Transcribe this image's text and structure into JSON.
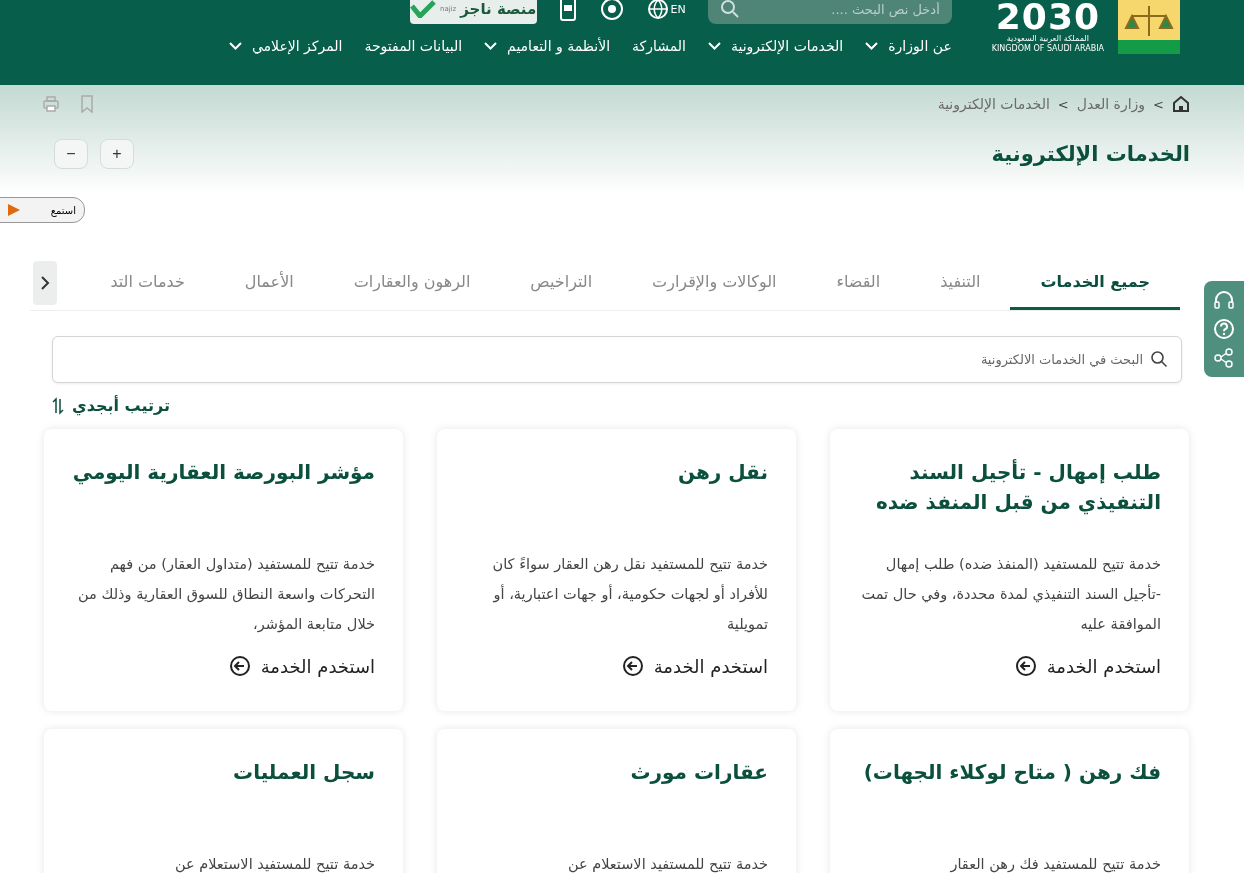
{
  "header": {
    "search": {
      "placeholder": "أدخل نص البحث ...."
    },
    "language": "EN",
    "najiz": {
      "label": "منصة ناجز",
      "sub": "najiz"
    },
    "vision": {
      "number": "2030",
      "arabic": "المملكة العربية السعودية",
      "english": "KINGDOM OF SAUDI ARABIA"
    },
    "nav": [
      {
        "label": "عن الوزارة",
        "dropdown": true
      },
      {
        "label": "الخدمات الإلكترونية",
        "dropdown": true
      },
      {
        "label": "المشاركة",
        "dropdown": false
      },
      {
        "label": "الأنظمة و التعاميم",
        "dropdown": true
      },
      {
        "label": "البيانات المفتوحة",
        "dropdown": false
      },
      {
        "label": "المركز الإعلامي",
        "dropdown": true
      }
    ]
  },
  "breadcrumb": [
    {
      "separator": ">",
      "label": "وزارة العدل"
    },
    {
      "separator": ">",
      "label": "الخدمات الإلكترونية"
    }
  ],
  "page_title": "الخدمات الإلكترونية",
  "zoom_buttons": [
    "+",
    "−"
  ],
  "listen": "استمع",
  "tabs": [
    {
      "label": "جميع الخدمات",
      "selected": true
    },
    {
      "label": "التنفيذ",
      "selected": false
    },
    {
      "label": "القضاء",
      "selected": false
    },
    {
      "label": "الوكالات والإقرارت",
      "selected": false
    },
    {
      "label": "التراخيص",
      "selected": false
    },
    {
      "label": "الرهون والعقارات",
      "selected": false
    },
    {
      "label": "الأعمال",
      "selected": false
    },
    {
      "label": "خدمات التد",
      "selected": false
    }
  ],
  "service_search": {
    "placeholder": "البحث في الخدمات الالكترونية"
  },
  "sort": "ترتيب أبجدي",
  "cards": [
    {
      "title": "طلب إمهال - تأجيل السند التنفيذي من قبل المنفذ ضده",
      "description": "خدمة تتيح للمستفيد (المنفذ ضده) طلب إمهال -تأجيل السند التنفيذي لمدة محددة، وفي حال تمت الموافقة عليه",
      "link": "استخدم الخدمة"
    },
    {
      "title": "نقل رهن",
      "description": "خدمة تتيح للمستفيد نقل رهن العقار سواءً كان للأفراد أو لجهات حكومية، أو جهات اعتبارية، أو تمويلية",
      "link": "استخدم الخدمة"
    },
    {
      "title": "مؤشر البورصة العقارية اليومي",
      "description": "خدمة تتيح للمستفيد (متداول العقار) من فهم التحركات واسعة النطاق للسوق العقارية وذلك من خلال متابعة المؤشر،",
      "link": "استخدم الخدمة"
    },
    {
      "title": "فك رهن ( متاح لوكلاء الجهات)",
      "description": "خدمة تتيح للمستفيد فك رهن العقار"
    },
    {
      "title": "عقارات مورث",
      "description": "خدمة تتيح للمستفيد الاستعلام عن"
    },
    {
      "title": "سجل العمليات",
      "description": "خدمة تتيح للمستفيد الاستعلام عن"
    }
  ]
}
